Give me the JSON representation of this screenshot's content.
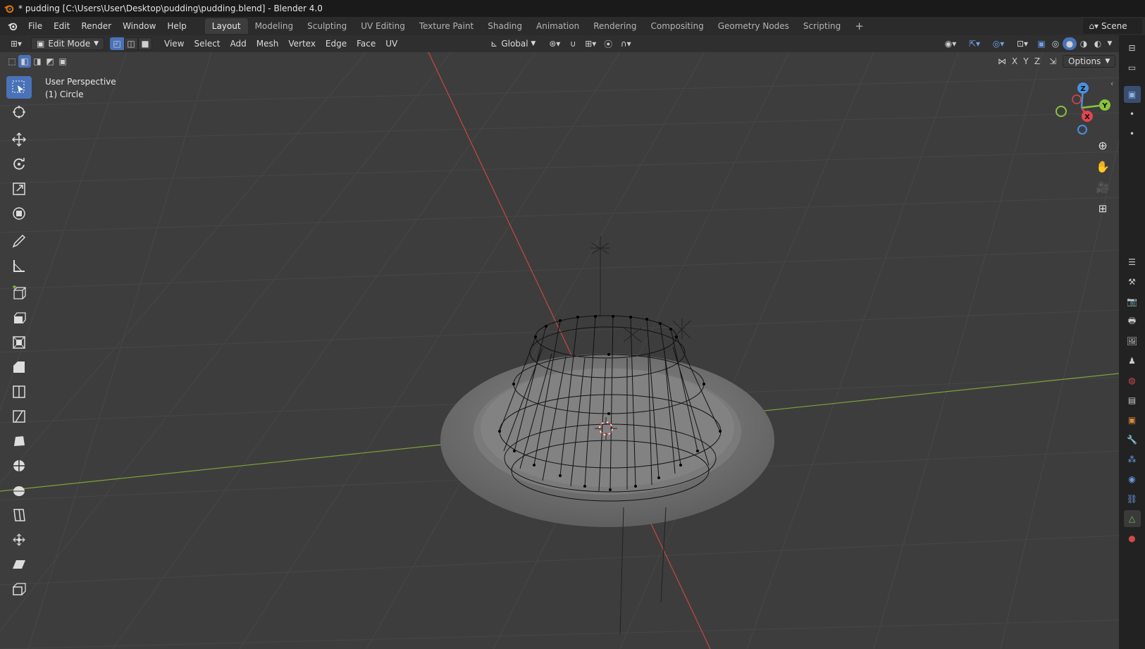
{
  "window": {
    "title": "* pudding [C:\\Users\\User\\Desktop\\pudding\\pudding.blend] - Blender 4.0"
  },
  "menu": {
    "items": [
      "File",
      "Edit",
      "Render",
      "Window",
      "Help"
    ]
  },
  "workspaces": {
    "tabs": [
      "Layout",
      "Modeling",
      "Sculpting",
      "UV Editing",
      "Texture Paint",
      "Shading",
      "Animation",
      "Rendering",
      "Compositing",
      "Geometry Nodes",
      "Scripting"
    ],
    "active": "Layout",
    "add_symbol": "+"
  },
  "scene": {
    "label": "Scene"
  },
  "header": {
    "mode": "Edit Mode",
    "menus": [
      "View",
      "Select",
      "Add",
      "Mesh",
      "Vertex",
      "Edge",
      "Face",
      "UV"
    ],
    "orientation": "Global",
    "options_label": "Options",
    "axes": [
      "X",
      "Y",
      "Z"
    ]
  },
  "viewport": {
    "perspective_label": "User Perspective",
    "object_label": "(1) Circle",
    "background_color": "#3d3d3d",
    "x_axis_color": "#c94646",
    "y_axis_color": "#7ea33a"
  },
  "gizmo": {
    "x": "X",
    "y": "Y",
    "z": "Z",
    "x_color": "#e04650",
    "y_color": "#8ac43a",
    "z_color": "#4a8fe0"
  },
  "toolbar": {
    "tools": [
      "select-box-icon",
      "cursor-icon",
      "move-icon",
      "rotate-icon",
      "scale-icon",
      "transform-icon",
      "annotate-icon",
      "measure-icon",
      "add-cube-icon",
      "extrude-icon",
      "inset-icon",
      "bevel-icon",
      "loop-cut-icon",
      "knife-icon",
      "poly-build-icon",
      "spin-icon",
      "smooth-icon",
      "edge-slide-icon",
      "shrink-fatten-icon",
      "shear-icon",
      "rip-icon"
    ],
    "active": "select-box-icon"
  },
  "properties_strip": {
    "icons": [
      "tool-icon",
      "render-icon",
      "output-icon",
      "view-layer-icon",
      "scene-icon",
      "world-icon",
      "collection-icon",
      "object-icon",
      "modifier-icon",
      "particles-icon",
      "physics-icon",
      "constraints-icon",
      "data-icon",
      "material-icon"
    ]
  }
}
